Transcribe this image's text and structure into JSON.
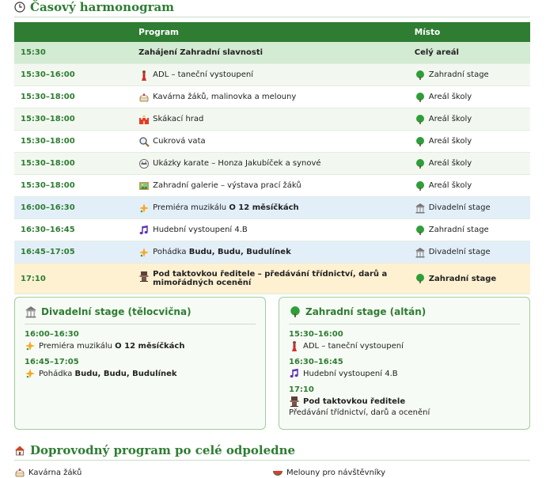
{
  "header": {
    "title": "Časový harmonogram",
    "icon": "clock-icon"
  },
  "schedule": {
    "columns": [
      "",
      "Program",
      "Místo"
    ],
    "rows": [
      {
        "time": "15:30",
        "icon": "",
        "program": "Zahájení Zahradní slavnosti",
        "place_icon": "",
        "place": "Celý areál"
      },
      {
        "time": "15:30–16:00",
        "icon": "dancer-icon",
        "program": "ADL – taneční vystoupení",
        "place_icon": "tree-icon",
        "place": "Zahradní stage"
      },
      {
        "time": "15:30–18:00",
        "icon": "cake-icon",
        "program": "Kavárna žáků, malinovka a melouny",
        "place_icon": "tree-icon",
        "place": "Areál školy"
      },
      {
        "time": "15:30–18:00",
        "icon": "castle-icon",
        "program": "Skákací hrad",
        "place_icon": "tree-icon",
        "place": "Areál školy"
      },
      {
        "time": "15:30–18:00",
        "icon": "magnifier-icon",
        "program": "Cukrová vata",
        "place_icon": "tree-icon",
        "place": "Areál školy"
      },
      {
        "time": "15:30–18:00",
        "icon": "karate-icon",
        "program": "Ukázky karate – Honza Jakubíček a synové",
        "place_icon": "tree-icon",
        "place": "Areál školy"
      },
      {
        "time": "15:30–18:00",
        "icon": "picture-icon",
        "program": "Zahradní galerie – výstava prací žáků",
        "place_icon": "tree-icon",
        "place": "Areál školy"
      },
      {
        "time": "16:00–16:30",
        "icon": "sparkle-icon",
        "program_pre": "Premiéra muzikálu ",
        "program_bold": "O 12 měsíčkách",
        "place_icon": "theatre-icon",
        "place": "Divadelní stage"
      },
      {
        "time": "16:30–16:45",
        "icon": "music-note-icon",
        "program": "Hudební vystoupení 4.B",
        "place_icon": "tree-icon",
        "place": "Zahradní stage"
      },
      {
        "time": "16:45–17:05",
        "icon": "sparkle-icon",
        "program_pre": "Pohádka ",
        "program_bold": "Budu, Budu, Budulínek",
        "place_icon": "theatre-icon",
        "place": "Divadelní stage"
      },
      {
        "time": "17:10",
        "icon": "podium-icon",
        "program": "Pod taktovkou ředitele – předávání třídnictví, darů a mimořádných ocenění",
        "place_icon": "tree-icon",
        "place": "Zahradní stage"
      }
    ]
  },
  "cards": {
    "divadelni": {
      "title": "Divadelní stage (tělocvična)",
      "icon": "theatre-icon",
      "entries": [
        {
          "time": "16:00–16:30",
          "icon": "sparkle-icon",
          "desc_pre": "Premiéra muzikálu ",
          "desc_bold": "O 12 měsíčkách"
        },
        {
          "time": "16:45–17:05",
          "icon": "sparkle-icon",
          "desc_pre": "Pohádka ",
          "desc_bold": "Budu, Budu, Budulínek"
        }
      ]
    },
    "zahradni": {
      "title": "Zahradní stage (altán)",
      "icon": "tree-icon",
      "entries": [
        {
          "time": "15:30–16:00",
          "icon": "dancer-icon",
          "desc": "ADL – taneční vystoupení"
        },
        {
          "time": "16:30–16:45",
          "icon": "music-note-icon",
          "desc": "Hudební vystoupení 4.B"
        },
        {
          "time": "17:10",
          "icon": "podium-icon",
          "desc_bold": "Pod taktovkou ředitele",
          "note": "Předávání třídnictví, darů a ocenění"
        }
      ]
    }
  },
  "side_program": {
    "title": "Doprovodný program po celé odpoledne",
    "icon": "house-icon",
    "items": [
      {
        "icon": "cake-icon",
        "label": "Kavárna žáků"
      },
      {
        "icon": "melon-icon",
        "label": "Melouny pro návštěvníky"
      }
    ]
  },
  "colors": {
    "accent": "#2e7d32",
    "header_bg": "#2e7d32",
    "opening_bg": "#d3ebd2",
    "row_alt_bg": "#f2f8ef",
    "theatre_row_bg": "#e3eff8",
    "highlight_row_bg": "#fdf1d2",
    "card_border": "#9ed09a"
  }
}
